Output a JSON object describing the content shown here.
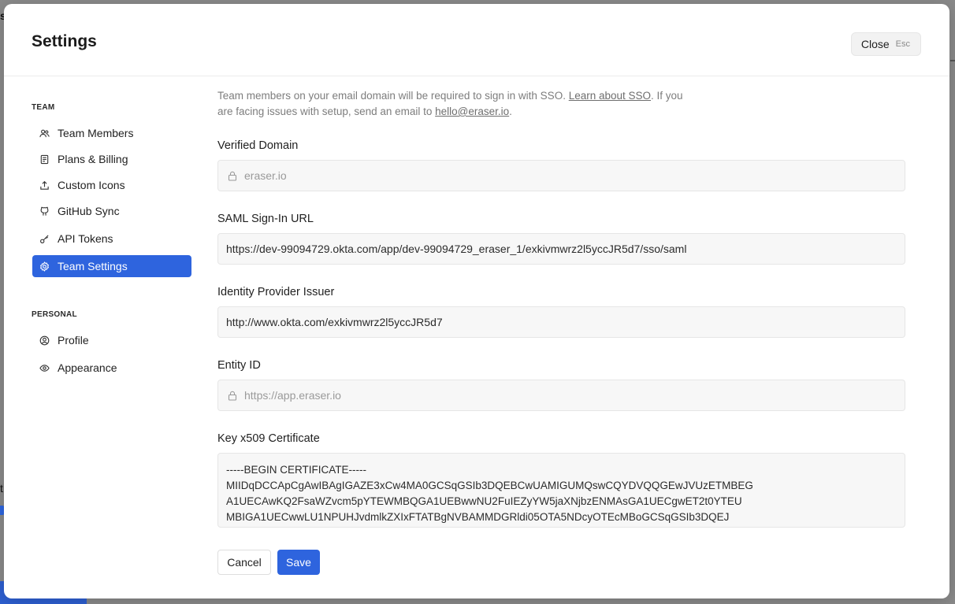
{
  "backdrop": {
    "left_text": "s",
    "left_text_2": "t"
  },
  "modal": {
    "title": "Settings",
    "close": {
      "label": "Close",
      "shortcut": "Esc"
    }
  },
  "sidebar": {
    "team_section": "TEAM",
    "team_items": [
      {
        "label": "Team Members",
        "icon": "users-icon"
      },
      {
        "label": "Plans & Billing",
        "icon": "receipt-icon"
      },
      {
        "label": "Custom Icons",
        "icon": "upload-icon"
      },
      {
        "label": "GitHub Sync",
        "icon": "github-icon"
      },
      {
        "label": "API Tokens",
        "icon": "key-icon"
      },
      {
        "label": "Team Settings",
        "icon": "gear-icon",
        "active": true
      }
    ],
    "personal_section": "PERSONAL",
    "personal_items": [
      {
        "label": "Profile",
        "icon": "user-circle-icon"
      },
      {
        "label": "Appearance",
        "icon": "eye-icon"
      }
    ]
  },
  "content": {
    "intro": {
      "line1_prefix": "Team members on your email domain will be required to sign in with SSO. ",
      "learn_link": "Learn about SSO",
      "line1_suffix": ". If you",
      "line2_prefix": "are facing issues with setup, send an email to ",
      "email_link": "hello@eraser.io",
      "line2_suffix": "."
    },
    "verified_domain": {
      "label": "Verified Domain",
      "value": "eraser.io"
    },
    "saml_url": {
      "label": "SAML Sign-In URL",
      "value": "https://dev-99094729.okta.com/app/dev-99094729_eraser_1/exkivmwrz2l5yccJR5d7/sso/saml"
    },
    "idp_issuer": {
      "label": "Identity Provider Issuer",
      "value": "http://www.okta.com/exkivmwrz2l5yccJR5d7"
    },
    "entity_id": {
      "label": "Entity ID",
      "value": "https://app.eraser.io"
    },
    "certificate": {
      "label": "Key x509 Certificate",
      "value": "-----BEGIN CERTIFICATE-----\nMIIDqDCCApCgAwIBAgIGAZE3xCw4MA0GCSqGSIb3DQEBCwUAMIGUMQswCQYDVQQGEwJVUzETMBEG\nA1UECAwKQ2FsaWZvcm5pYTEWMBQGA1UEBwwNU2FuIEZyYW5jaXNjbzENMAsGA1UECgwET2t0YTEU\nMBIGA1UECwwLU1NPUHJvdmlkZXIxFTATBgNVBAMMDGRldi05OTA5NDcyOTEcMBoGCSqGSIb3DQEJ"
    },
    "actions": {
      "cancel": "Cancel",
      "save": "Save"
    }
  },
  "colors": {
    "accent": "#2e64de",
    "muted_text": "#7d7d7d",
    "field_bg": "#f7f7f7"
  }
}
